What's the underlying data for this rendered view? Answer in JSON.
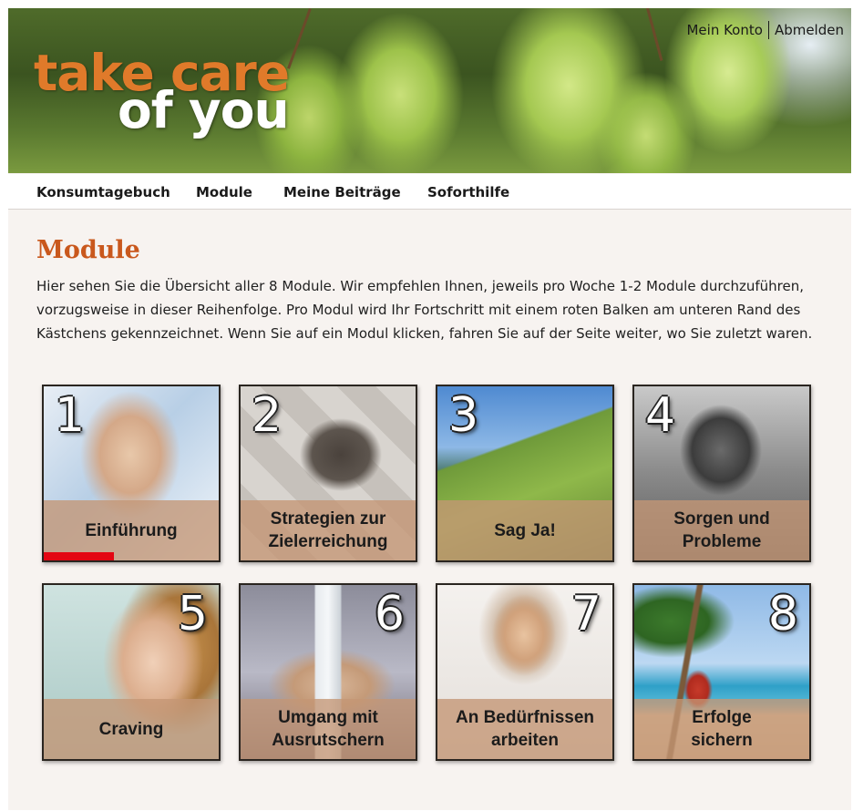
{
  "header": {
    "brand_line1": "take care",
    "brand_line2": "of you",
    "account_label": "Mein Konto",
    "logout_label": "Abmelden"
  },
  "nav": {
    "items": [
      {
        "label": "Konsumtagebuch"
      },
      {
        "label": "Module"
      },
      {
        "label": "Meine Beiträge"
      },
      {
        "label": "Sofort­hilfe"
      }
    ]
  },
  "page": {
    "title": "Module",
    "intro": "Hier sehen Sie die Übersicht aller 8 Module. Wir empfehlen Ihnen, jeweils pro Woche 1-2 Module durchzuführen, vorzugsweise in dieser Reihenfolge. Pro Modul wird Ihr Fortschritt mit einem roten Balken am unteren Rand des Kästchens gekennzeichnet. Wenn Sie auf ein Modul klicken, fahren Sie auf der Seite weiter, wo Sie zuletzt waren."
  },
  "modules": [
    {
      "number": "1",
      "label": "Einführung",
      "progress": 0.4,
      "icon": "handshake-photo"
    },
    {
      "number": "2",
      "label": "Strategien zur\nZielerreichung",
      "progress": 0,
      "icon": "puzzle-photo"
    },
    {
      "number": "3",
      "label": "Sag Ja!",
      "progress": 0,
      "icon": "mountain-hikers-photo"
    },
    {
      "number": "4",
      "label": "Sorgen und\nProbleme",
      "progress": 0,
      "icon": "worried-man-photo"
    },
    {
      "number": "5",
      "label": "Craving",
      "progress": 0,
      "icon": "nail-biting-woman-photo"
    },
    {
      "number": "6",
      "label": "Umgang mit\nAusrutschern",
      "progress": 0,
      "icon": "bottle-sleeping-man-photo"
    },
    {
      "number": "7",
      "label": "An Bedürfnissen\narbeiten",
      "progress": 0,
      "icon": "breakfast-woman-photo"
    },
    {
      "number": "8",
      "label": "Erfolge\nsichern",
      "progress": 0,
      "icon": "beach-palm-photo"
    }
  ],
  "colors": {
    "accent_orange": "#c9581d",
    "progress_red": "#e30613",
    "label_band": "#c49674"
  }
}
